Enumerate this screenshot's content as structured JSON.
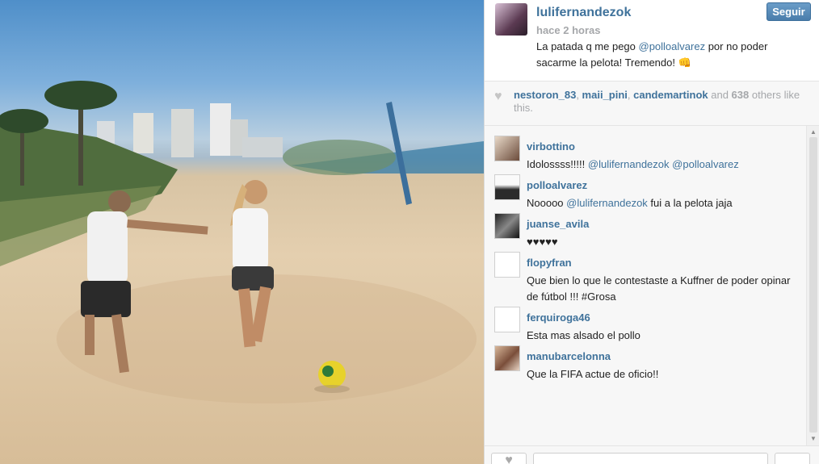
{
  "photo": {
    "alt": "beach soccer photo"
  },
  "post": {
    "owner": "lulifernandezok",
    "time": "hace 2 horas",
    "caption_pre": "La patada q me pego ",
    "caption_mention": "@polloalvarez",
    "caption_post": " por no poder sacarme la pelota! Tremendo! 👊",
    "follow_label": "Seguir"
  },
  "likes": {
    "user1": "nestoron_83",
    "sep1": ", ",
    "user2": "maii_pini",
    "sep2": ", ",
    "user3": "candemartinok",
    "and_text": " and ",
    "count": "638",
    "others_text": " others like this."
  },
  "comments": [
    {
      "user": "virbottino",
      "pre": "Idolossss!!!!! ",
      "m1": "@lulifernandezok",
      "mid": " ",
      "m2": "@polloalvarez",
      "post": ""
    },
    {
      "user": "polloalvarez",
      "pre": "Nooooo ",
      "m1": "@lulifernandezok",
      "mid": "",
      "m2": "",
      "post": " fui a la pelota jaja"
    },
    {
      "user": "juanse_avila",
      "pre": "♥♥♥♥♥",
      "m1": "",
      "mid": "",
      "m2": "",
      "post": ""
    },
    {
      "user": "flopyfran",
      "pre": "Que bien lo que le contestaste a Kuffner de poder opinar de fútbol !!! #Grosa",
      "m1": "",
      "mid": "",
      "m2": "",
      "post": ""
    },
    {
      "user": "ferquiroga46",
      "pre": "Esta mas alsado el pollo",
      "m1": "",
      "mid": "",
      "m2": "",
      "post": ""
    },
    {
      "user": "manubarcelonna",
      "pre": "Que la FIFA actue de oficio!!",
      "m1": "",
      "mid": "",
      "m2": "",
      "post": ""
    }
  ],
  "colors": {
    "link": "#3f729b",
    "muted": "#a5a7aa",
    "follow_bg": "#5a8cba"
  },
  "icons": {
    "like": "heart-icon",
    "scroll_up": "arrow-up-icon",
    "scroll_down": "arrow-down-icon"
  }
}
